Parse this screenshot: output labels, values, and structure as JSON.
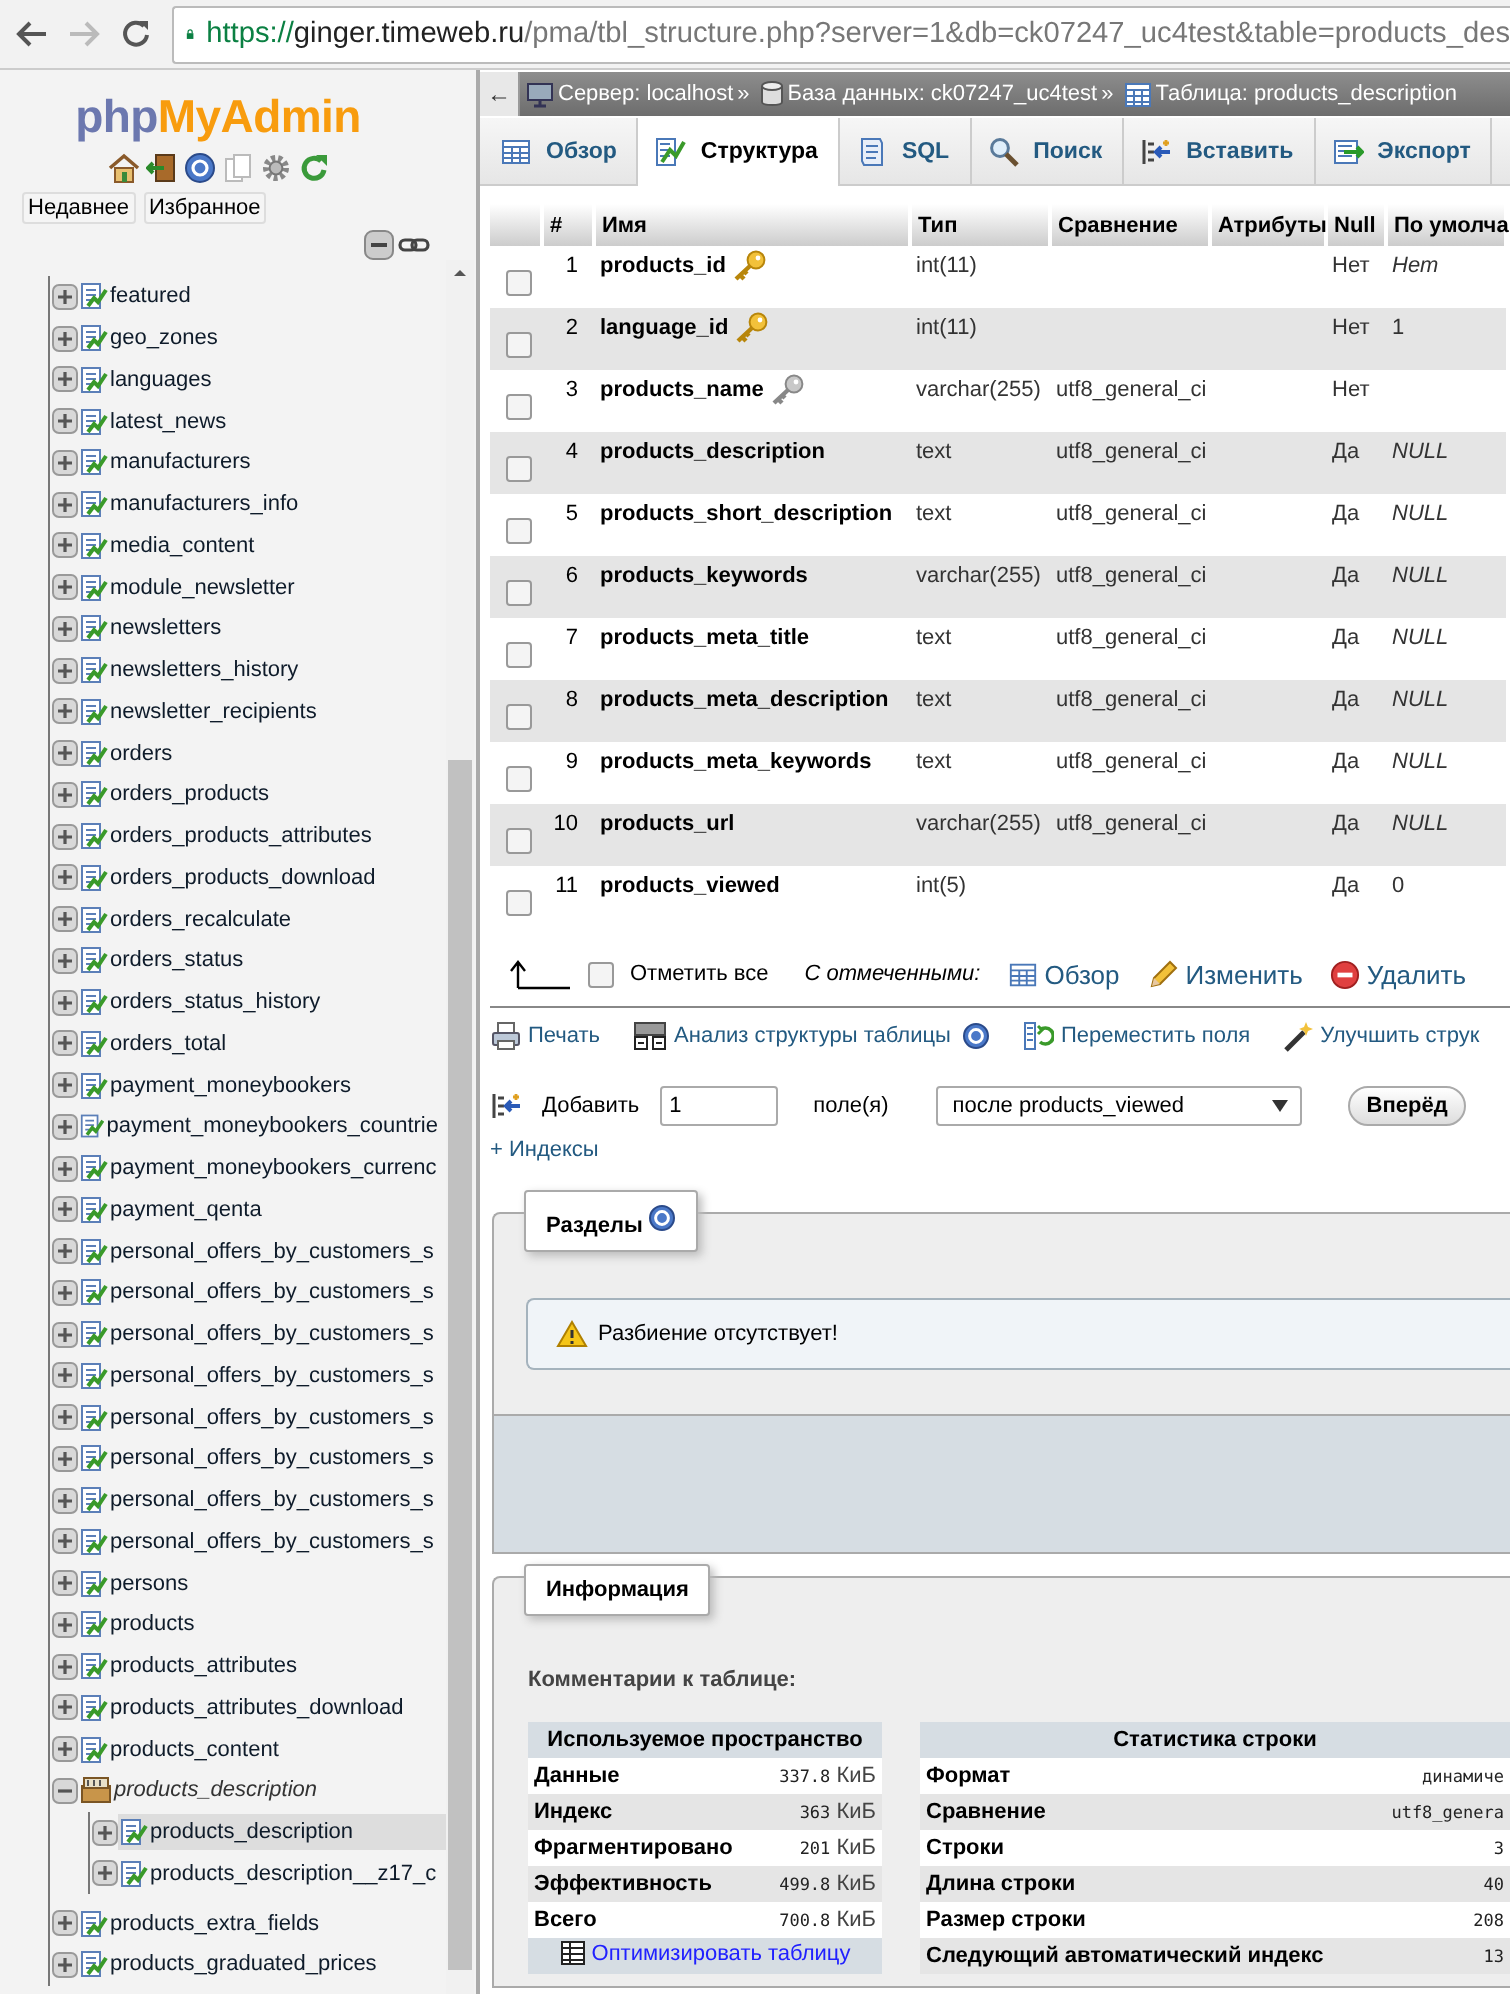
{
  "browser": {
    "back": "←",
    "url_scheme": "https://",
    "url_host": "ginger.timeweb.ru",
    "url_path": "/pma/tbl_structure.php?server=1&db=ck07247_uc4test&table=products_des"
  },
  "sidebar": {
    "logo_php": "php",
    "logo_myadmin": "MyAdmin",
    "buttons": [
      "Недавнее",
      "Избранное"
    ],
    "tree": [
      {
        "name": "featured",
        "expanded": false,
        "selected": false
      },
      {
        "name": "geo_zones",
        "expanded": false,
        "selected": false
      },
      {
        "name": "languages",
        "expanded": false,
        "selected": false
      },
      {
        "name": "latest_news",
        "expanded": false,
        "selected": false
      },
      {
        "name": "manufacturers",
        "expanded": false,
        "selected": false
      },
      {
        "name": "manufacturers_info",
        "expanded": false,
        "selected": false
      },
      {
        "name": "media_content",
        "expanded": false,
        "selected": false
      },
      {
        "name": "module_newsletter",
        "expanded": false,
        "selected": false
      },
      {
        "name": "newsletters",
        "expanded": false,
        "selected": false
      },
      {
        "name": "newsletters_history",
        "expanded": false,
        "selected": false
      },
      {
        "name": "newsletter_recipients",
        "expanded": false,
        "selected": false
      },
      {
        "name": "orders",
        "expanded": false,
        "selected": false
      },
      {
        "name": "orders_products",
        "expanded": false,
        "selected": false
      },
      {
        "name": "orders_products_attributes",
        "expanded": false,
        "selected": false
      },
      {
        "name": "orders_products_download",
        "expanded": false,
        "selected": false
      },
      {
        "name": "orders_recalculate",
        "expanded": false,
        "selected": false
      },
      {
        "name": "orders_status",
        "expanded": false,
        "selected": false
      },
      {
        "name": "orders_status_history",
        "expanded": false,
        "selected": false
      },
      {
        "name": "orders_total",
        "expanded": false,
        "selected": false
      },
      {
        "name": "payment_moneybookers",
        "expanded": false,
        "selected": false
      },
      {
        "name": "payment_moneybookers_countrie",
        "expanded": false,
        "selected": false
      },
      {
        "name": "payment_moneybookers_currenc",
        "expanded": false,
        "selected": false
      },
      {
        "name": "payment_qenta",
        "expanded": false,
        "selected": false
      },
      {
        "name": "personal_offers_by_customers_s",
        "expanded": false,
        "selected": false
      },
      {
        "name": "personal_offers_by_customers_s",
        "expanded": false,
        "selected": false
      },
      {
        "name": "personal_offers_by_customers_s",
        "expanded": false,
        "selected": false
      },
      {
        "name": "personal_offers_by_customers_s",
        "expanded": false,
        "selected": false
      },
      {
        "name": "personal_offers_by_customers_s",
        "expanded": false,
        "selected": false
      },
      {
        "name": "personal_offers_by_customers_s",
        "expanded": false,
        "selected": false
      },
      {
        "name": "personal_offers_by_customers_s",
        "expanded": false,
        "selected": false
      },
      {
        "name": "personal_offers_by_customers_s",
        "expanded": false,
        "selected": false
      },
      {
        "name": "persons",
        "expanded": false,
        "selected": false
      },
      {
        "name": "products",
        "expanded": false,
        "selected": false
      },
      {
        "name": "products_attributes",
        "expanded": false,
        "selected": false
      },
      {
        "name": "products_attributes_download",
        "expanded": false,
        "selected": false
      },
      {
        "name": "products_content",
        "expanded": false,
        "selected": false
      },
      {
        "name": "products_description",
        "expanded": true,
        "selected": false,
        "children": [
          {
            "name": "products_description",
            "expanded": false,
            "selected": true
          },
          {
            "name": "products_description__z17_c",
            "expanded": false,
            "selected": false
          }
        ]
      },
      {
        "name": "products_extra_fields",
        "expanded": false,
        "selected": false
      },
      {
        "name": "products_graduated_prices",
        "expanded": false,
        "selected": false
      }
    ]
  },
  "breadcrumb": [
    {
      "kind": "server",
      "text": "Сервер: localhost",
      "separator": "»"
    },
    {
      "kind": "database",
      "text": "База данных: ck07247_uc4test",
      "separator": "»"
    },
    {
      "kind": "table",
      "text": "Таблица: products_description"
    }
  ],
  "tabs": [
    {
      "kind": "browse",
      "label": "Обзор",
      "selected": false
    },
    {
      "kind": "structure",
      "label": "Структура",
      "selected": true
    },
    {
      "kind": "sql",
      "label": "SQL",
      "selected": false
    },
    {
      "kind": "search",
      "label": "Поиск",
      "selected": false
    },
    {
      "kind": "insert",
      "label": "Вставить",
      "selected": false
    },
    {
      "kind": "export",
      "label": "Экспорт",
      "selected": false
    }
  ],
  "structure_table": {
    "columns": [
      "#",
      "Имя",
      "Тип",
      "Сравнение",
      "Атрибуты",
      "Null",
      "По умолча"
    ],
    "rows": [
      {
        "checked": false,
        "num": "1",
        "name": "products_id",
        "kind": "primary",
        "type": "int(11)",
        "null": "Нет",
        "default": "Нет",
        "default_italic": true
      },
      {
        "checked": false,
        "num": "2",
        "name": "language_id",
        "kind": "primary",
        "type": "int(11)",
        "null": "Нет",
        "default": "1",
        "default_italic": false
      },
      {
        "checked": false,
        "num": "3",
        "name": "products_name",
        "kind": "unique",
        "type": "varchar(255)",
        "collation": "utf8_general_ci",
        "null": "Нет"
      },
      {
        "checked": false,
        "num": "4",
        "name": "products_description",
        "type": "text",
        "collation": "utf8_general_ci",
        "null": "Да",
        "default": "NULL",
        "default_italic": true
      },
      {
        "checked": false,
        "num": "5",
        "name": "products_short_description",
        "type": "text",
        "collation": "utf8_general_ci",
        "null": "Да",
        "default": "NULL",
        "default_italic": true
      },
      {
        "checked": false,
        "num": "6",
        "name": "products_keywords",
        "type": "varchar(255)",
        "collation": "utf8_general_ci",
        "null": "Да",
        "default": "NULL",
        "default_italic": true
      },
      {
        "checked": false,
        "num": "7",
        "name": "products_meta_title",
        "type": "text",
        "collation": "utf8_general_ci",
        "null": "Да",
        "default": "NULL",
        "default_italic": true
      },
      {
        "checked": false,
        "num": "8",
        "name": "products_meta_description",
        "type": "text",
        "collation": "utf8_general_ci",
        "null": "Да",
        "default": "NULL",
        "default_italic": true
      },
      {
        "checked": false,
        "num": "9",
        "name": "products_meta_keywords",
        "type": "text",
        "collation": "utf8_general_ci",
        "null": "Да",
        "default": "NULL",
        "default_italic": true
      },
      {
        "checked": false,
        "num": "10",
        "name": "products_url",
        "type": "varchar(255)",
        "collation": "utf8_general_ci",
        "null": "Да",
        "default": "NULL",
        "default_italic": true
      },
      {
        "checked": false,
        "num": "11",
        "name": "products_viewed",
        "type": "int(5)",
        "null": "Да",
        "default": "0",
        "default_italic": false
      }
    ]
  },
  "bulk_actions": {
    "check_all": {
      "label": "Отметить все",
      "checked": false
    },
    "with_selected": "С отмеченными:",
    "actions": [
      {
        "kind": "browse",
        "label": "Обзор"
      },
      {
        "kind": "edit",
        "label": "Изменить"
      },
      {
        "kind": "drop",
        "label": "Удалить"
      }
    ]
  },
  "tools": [
    {
      "kind": "print",
      "label": "Печать"
    },
    {
      "kind": "analyze",
      "label": "Анализ структуры таблицы",
      "help": true
    },
    {
      "kind": "move",
      "label": "Переместить поля"
    },
    {
      "kind": "improve",
      "label": "Улучшить струк"
    }
  ],
  "add_fields": {
    "label": "Добавить",
    "count": "1",
    "unit": "поле(я)",
    "position": "после products_viewed",
    "button": "Вперёд"
  },
  "indexes_link": "+ Индексы",
  "partitions": {
    "legend": "Разделы",
    "message": "Разбиение отсутствует!"
  },
  "information": {
    "legend": "Информация",
    "comment_label": "Комментарии к таблице:",
    "space": {
      "title": "Используемое пространство",
      "rows": [
        {
          "label": "Данные",
          "value": "337.8",
          "unit": "КиБ"
        },
        {
          "label": "Индекс",
          "value": "363",
          "unit": "КиБ"
        },
        {
          "label": "Фрагментировано",
          "value": "201",
          "unit": "КиБ"
        },
        {
          "label": "Эффективность",
          "value": "499.8",
          "unit": "КиБ"
        },
        {
          "label": "Всего",
          "value": "700.8",
          "unit": "КиБ"
        }
      ],
      "optimize_link": "Оптимизировать таблицу"
    },
    "row_stats": {
      "title": "Статистика строки",
      "rows": [
        {
          "label": "Формат",
          "value": "динамиче"
        },
        {
          "label": "Сравнение",
          "value": "utf8_genera"
        },
        {
          "label": "Строки",
          "value": "3"
        },
        {
          "label": "Длина строки",
          "value": "40"
        },
        {
          "label": "Размер строки",
          "value": "208"
        },
        {
          "label": "Следующий автоматический индекс",
          "value": "13"
        }
      ]
    }
  }
}
